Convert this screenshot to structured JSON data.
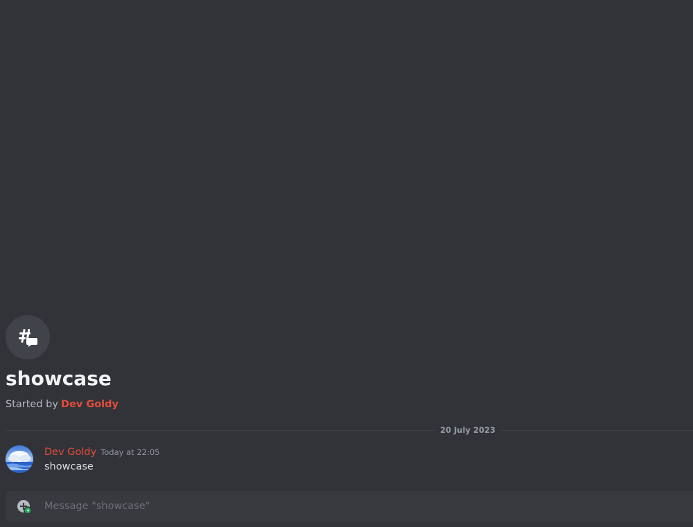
{
  "thread": {
    "icon": "thread-icon",
    "title": "showcase",
    "started_by_label": "Started by",
    "started_by_author": "Dev Goldy"
  },
  "divider": {
    "date": "20 July 2023"
  },
  "message": {
    "avatar": "sky-ocean-avatar",
    "author": "Dev Goldy",
    "timestamp": "Today at 22:05",
    "content": "showcase"
  },
  "composer": {
    "attach_icon": "add-circle-icon",
    "placeholder": "Message \"showcase\""
  },
  "colors": {
    "background": "#313338",
    "author": "#e74c3c",
    "composer": "#383a40"
  }
}
